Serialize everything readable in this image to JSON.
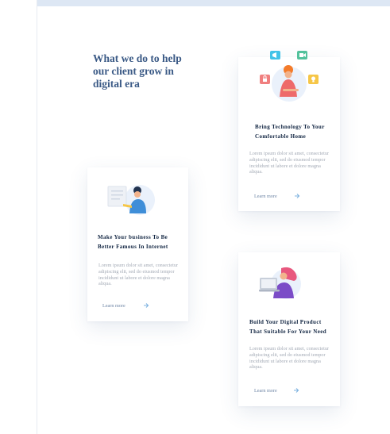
{
  "section": {
    "heading": "What we do to help our client grow in digital era"
  },
  "cards": [
    {
      "title": "Bring Technology To Your Comfortable Home",
      "description": "Lorem ipsum dolor sit amet, consectetur adipiscing elit, sed do eiusmod tempor incididunt ut labore et dolore magna aliqua.",
      "link_label": "Learn more"
    },
    {
      "title": "Make Your business To Be Better Famous In Internet",
      "description": "Lorem ipsum dolor sit amet, consectetur adipiscing elit, sed do eiusmod tempor incididunt ut labore et dolore magna aliqua.",
      "link_label": "Learn more"
    },
    {
      "title": "Build Your Digital Product That Suitable For Your Need",
      "description": "Lorem ipsum dolor sit amet, consectetur adipiscing elit, sed do eiusmod tempor incididunt ut labore et dolore magna aliqua.",
      "link_label": "Learn more"
    }
  ],
  "icons": {
    "card_0": [
      "smart-home-illustration-icon",
      "megaphone-icon",
      "video-camera-icon",
      "lock-icon",
      "lightbulb-icon"
    ],
    "card_1": [
      "marketing-illustration-icon"
    ],
    "card_2": [
      "laptop-developer-illustration-icon"
    ],
    "link_arrow": "arrow-right-icon"
  },
  "colors": {
    "heading": "#3b5a86",
    "card_title": "#0f2340",
    "body_text": "#a4abb6",
    "link": "#6f86a6",
    "arrow": "#7fb3e0",
    "top_strip": "#dde7f4"
  }
}
